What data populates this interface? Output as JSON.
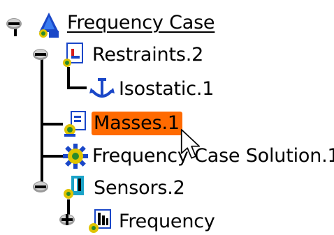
{
  "tree": {
    "nodes": [
      {
        "label": "Frequency Case",
        "icon": "frequency-case-icon",
        "expander": "minus",
        "state": "root"
      },
      {
        "label": "Restraints.2",
        "icon": "restraints-icon",
        "expander": "minus",
        "state": "normal"
      },
      {
        "label": "Isostatic.1",
        "icon": "isostatic-anchor-icon",
        "expander": "none",
        "state": "normal"
      },
      {
        "label": "Masses.1",
        "icon": "masses-icon",
        "expander": "none",
        "state": "selected"
      },
      {
        "label": "Frequency Case Solution.1",
        "icon": "solution-gear-icon",
        "expander": "none",
        "state": "normal"
      },
      {
        "label": "Sensors.2",
        "icon": "sensors-icon",
        "expander": "minus",
        "state": "normal"
      },
      {
        "label": "Frequency",
        "icon": "frequency-sensor-icon",
        "expander": "plus",
        "state": "normal"
      }
    ]
  },
  "colors": {
    "selection": "#ff6a00",
    "connector": "#000000"
  },
  "cursor": {
    "icon": "mouse-pointer-icon"
  }
}
